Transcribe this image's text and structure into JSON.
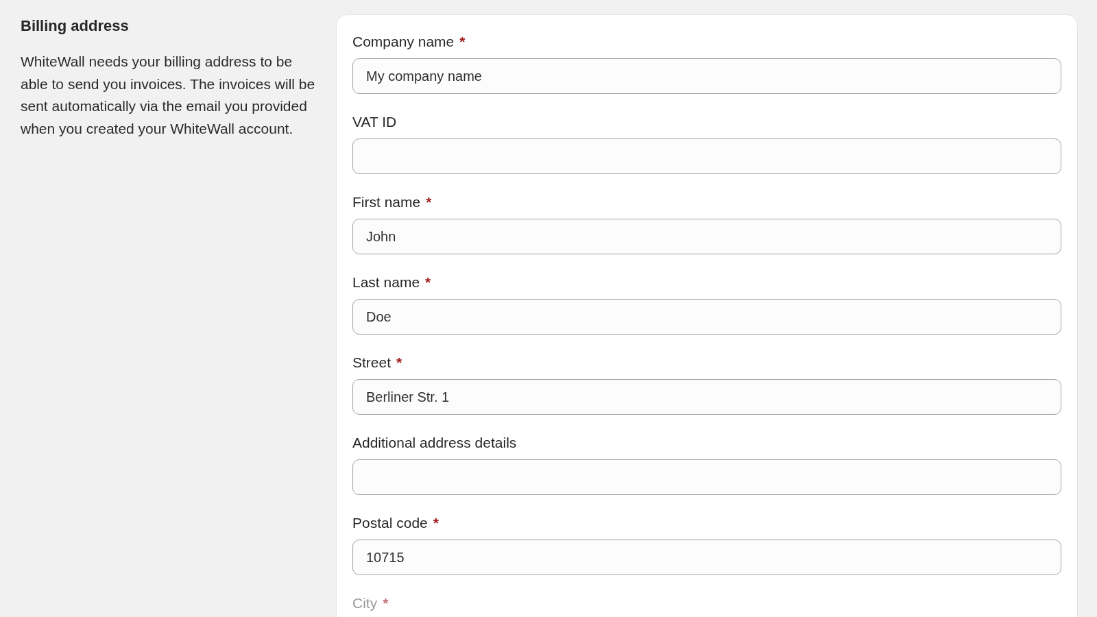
{
  "section": {
    "title": "Billing address",
    "description": "WhiteWall needs your billing address to be able to send you invoices. The invoices will be sent automatically via the email you provided when you created your WhiteWall account."
  },
  "fields": [
    {
      "label": "Company name",
      "required_mark": "*",
      "value": "My company name"
    },
    {
      "label": "VAT ID"
    },
    {
      "label": "First name",
      "required_mark": "*",
      "value": "John"
    },
    {
      "label": "Last name",
      "required_mark": "*",
      "value": "Doe"
    },
    {
      "label": "Street",
      "required_mark": "*",
      "value": "Berliner Str. 1"
    },
    {
      "label": "Additional address details"
    },
    {
      "label": "Postal code",
      "required_mark": "*",
      "value": "10715"
    },
    {
      "label": "City",
      "required_mark": "*",
      "kind": "faded"
    }
  ]
}
